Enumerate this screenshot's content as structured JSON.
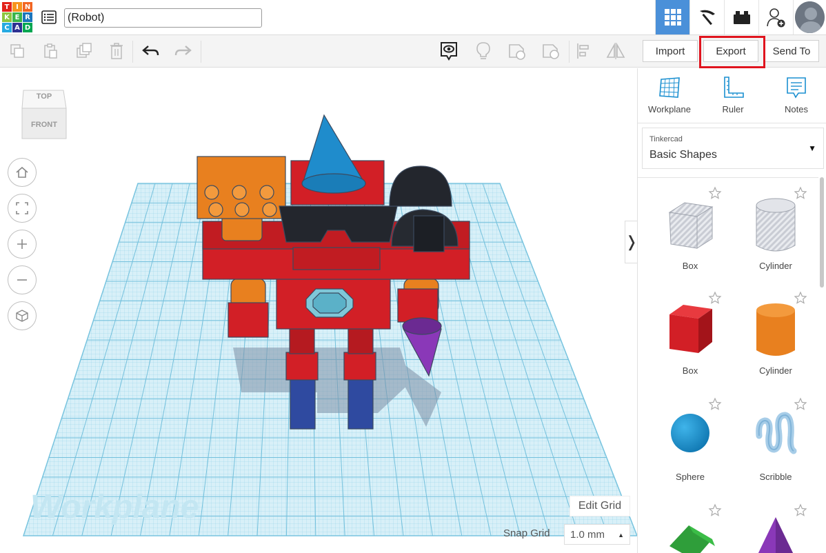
{
  "app": {
    "logo_letters": [
      "T",
      "I",
      "N",
      "K",
      "E",
      "R",
      "C",
      "A",
      "D"
    ],
    "logo_colors": [
      "#e2231a",
      "#f7941d",
      "#f26522",
      "#8dc63f",
      "#39b54a",
      "#1b75bc",
      "#27aae1",
      "#2e3192",
      "#00a651"
    ],
    "design_title": "(Robot)"
  },
  "toolbar": {
    "import_label": "Import",
    "export_label": "Export",
    "send_to_label": "Send To"
  },
  "viewport": {
    "viewcube_top": "TOP",
    "viewcube_front": "FRONT",
    "workplane_watermark": "Workplane",
    "edit_grid_label": "Edit Grid",
    "snap_grid_label": "Snap Grid",
    "snap_grid_value": "1.0 mm"
  },
  "panel": {
    "tools": [
      {
        "label": "Workplane",
        "icon": "workplane-icon"
      },
      {
        "label": "Ruler",
        "icon": "ruler-icon"
      },
      {
        "label": "Notes",
        "icon": "notes-icon"
      }
    ],
    "library_provider": "Tinkercad",
    "library_name": "Basic Shapes",
    "shapes": [
      {
        "label": "Box",
        "color": "#b8bcc6"
      },
      {
        "label": "Cylinder",
        "color": "#b8bcc6"
      },
      {
        "label": "Box",
        "color": "#d21f26"
      },
      {
        "label": "Cylinder",
        "color": "#e8801f"
      },
      {
        "label": "Sphere",
        "color": "#1a9ad6"
      },
      {
        "label": "Scribble",
        "color": "#a7cde8"
      }
    ]
  },
  "colors": {
    "accent": "#4a90d9",
    "highlight": "#e0141e",
    "grid": "#bfe3f2"
  }
}
